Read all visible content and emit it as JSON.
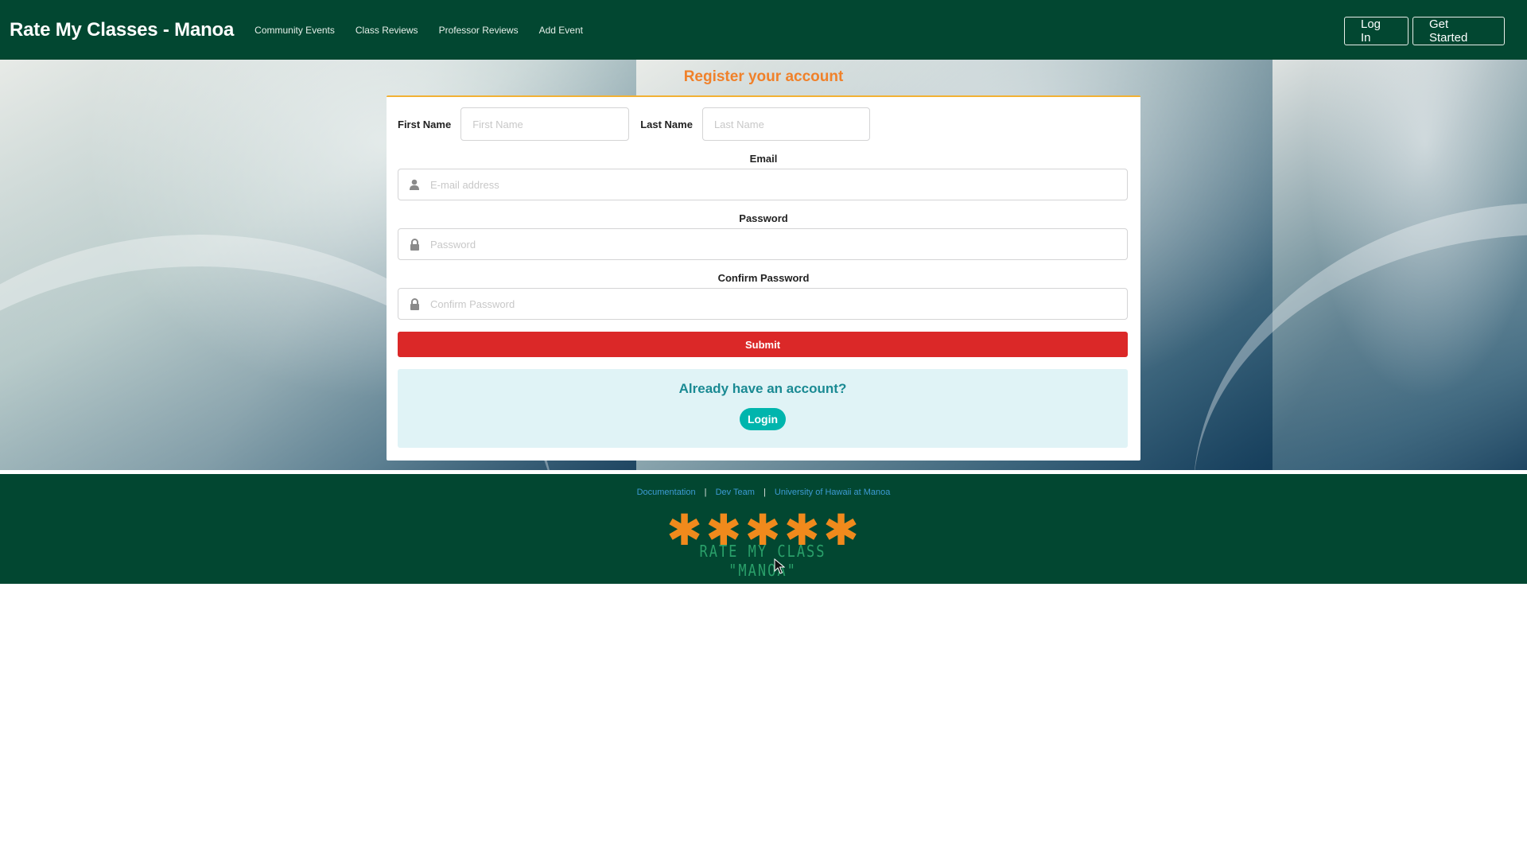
{
  "navbar": {
    "brand": "Rate My Classes - Manoa",
    "links": [
      "Community Events",
      "Class Reviews",
      "Professor Reviews",
      "Add Event"
    ],
    "login_label": "Log In",
    "get_started_label": "Get Started"
  },
  "register": {
    "title": "Register your account",
    "first_name_label": "First Name",
    "first_name_placeholder": "First Name",
    "last_name_label": "Last Name",
    "last_name_placeholder": "Last Name",
    "email_label": "Email",
    "email_placeholder": "E-mail address",
    "password_label": "Password",
    "password_placeholder": "Password",
    "confirm_label": "Confirm Password",
    "confirm_placeholder": "Confirm Password",
    "submit_label": "Submit",
    "already_text": "Already have an account?",
    "login_label": "Login"
  },
  "footer": {
    "links": [
      "Documentation",
      "Dev Team",
      "University of Hawaii at Manoa"
    ],
    "separator": "|",
    "logo_text": "RATE MY CLASS \"MANOA\""
  },
  "colors": {
    "nav_bg": "#024731",
    "title_orange": "#f0812a",
    "submit_red": "#db2828",
    "login_teal": "#00b5ad",
    "info_bg": "#e0f3f6",
    "footer_link": "#3d9bd4",
    "logo_star": "#f08a1c"
  },
  "icons": {
    "email": "user-icon",
    "password": "lock-icon",
    "confirm": "lock-icon",
    "logo": "asterisk-stars"
  }
}
